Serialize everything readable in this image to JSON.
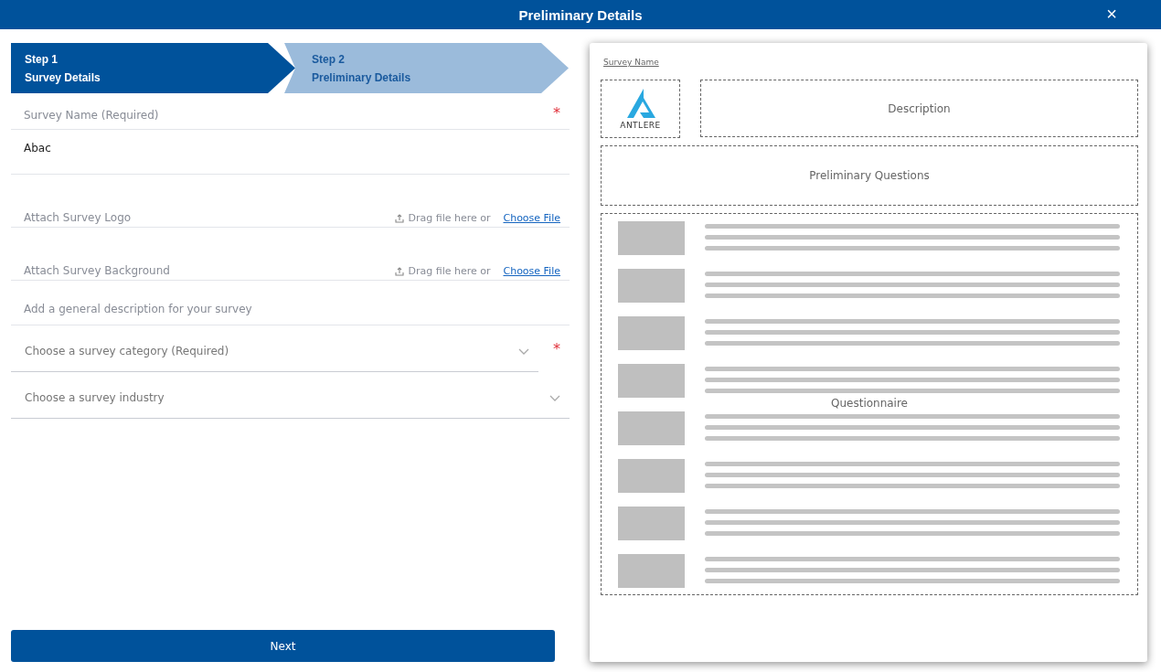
{
  "window": {
    "title": "Preliminary Details",
    "close": "×"
  },
  "steps": [
    {
      "number": "Step 1",
      "title": "Survey Details",
      "selected": true
    },
    {
      "number": "Step 2",
      "title": "Preliminary Details",
      "selected": false
    }
  ],
  "fields": [
    {
      "kind": "label",
      "label": "Survey Name (Required)",
      "required_mark": "*"
    },
    {
      "kind": "value",
      "value": "Abac"
    },
    {
      "kind": "file",
      "label": "Attach Survey Logo",
      "hint": "Drag file here or",
      "link": "Choose File"
    },
    {
      "kind": "file",
      "label": "Attach Survey Background",
      "hint": "Drag file here or",
      "link": "Choose File"
    },
    {
      "kind": "textarea",
      "placeholder": "Add a general description for your survey"
    },
    {
      "kind": "select",
      "placeholder": "Choose a survey category (Required)",
      "required_mark": "*"
    },
    {
      "kind": "select",
      "placeholder": "Choose a survey industry"
    }
  ],
  "next_button": "Next",
  "preview": {
    "survey_name": "Survey Name",
    "logo_text": "ANTLERE",
    "description": "Description",
    "preliminary_questions": "Preliminary Questions",
    "questionnaire": "Questionnaire"
  }
}
